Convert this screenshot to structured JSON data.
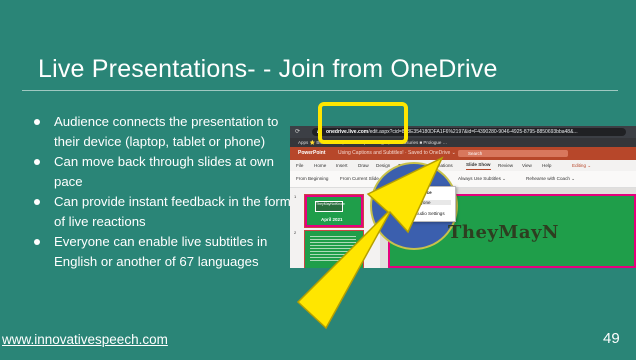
{
  "slide": {
    "title": "Live Presentations- - Join from OneDrive",
    "bullets": [
      "Audience connects the presentation to their device (laptop, tablet or phone)",
      "Can move back through slides at own pace",
      "Can provide instant feedback in the form of live reactions",
      "Everyone can enable live subtitles in English or another of 67 languages"
    ],
    "footer_link": "www.innovativespeech.com",
    "page_number": "49"
  },
  "screenshot": {
    "url_host": "onedrive.live.com",
    "url_rest": "/edit.aspx?cid=848E354180DFA1F6%2197&id=F4390280-9046-4925-8795-8850693bba48&...",
    "bookmarks": "Apps  ⭐ Bookmarks  f  ▶  BT Group  G Google  ▶  ● Treasuries  ■ Prologue  …",
    "app_name": "PowerPoint",
    "doc_title": "Using Captions and Subtitles!  ·  Saved to OneDrive ⌄",
    "search_placeholder": "Search",
    "menus": [
      "File",
      "Home",
      "Insert",
      "Draw",
      "Design",
      "Transitions",
      "Animations",
      "Slide Show",
      "Review",
      "View",
      "Help"
    ],
    "editing_label": "Editing ⌄",
    "ribbon": {
      "from_beginning": "From Beginning",
      "from_current": "From Current Slide",
      "present_live": "Present Live ⌄",
      "always_use_subtitles": "Always Use Subtitles ⌄",
      "rehearse": "Rehearse with Coach ⌄"
    },
    "dropdown": {
      "heading": "Audience",
      "option1": "Anyone",
      "option2": "Audio Settings"
    },
    "thumb_logo": "TheyMayNotKnow",
    "thumb_date": "April 2021",
    "slide_numbers": [
      "1",
      "2"
    ],
    "big_slide_text": "TheyMayN"
  },
  "colors": {
    "background": "#2a8577",
    "highlight": "#ffe600",
    "powerpoint": "#b7472a"
  }
}
